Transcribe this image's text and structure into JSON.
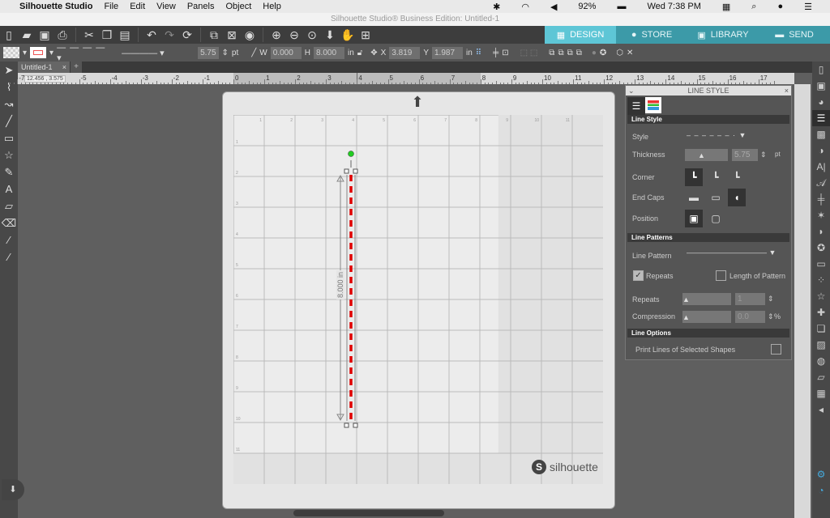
{
  "menubar": {
    "app": "Silhouette Studio",
    "items": [
      "File",
      "Edit",
      "View",
      "Panels",
      "Object",
      "Help"
    ],
    "battery": "92%",
    "clock": "Wed 7:38 PM"
  },
  "window_title": "Silhouette Studio® Business Edition: Untitled-1",
  "toolbar": {
    "icons": [
      "new-file",
      "open-folder",
      "save",
      "print",
      "cut",
      "copy",
      "paste",
      "undo",
      "redo",
      "replicate",
      "group",
      "ungroup",
      "release",
      "zoom-in",
      "zoom-out",
      "zoom-select",
      "pan-down",
      "hand",
      "fit-page"
    ],
    "nav_tabs": [
      {
        "label": "DESIGN",
        "active": true
      },
      {
        "label": "STORE"
      },
      {
        "label": "LIBRARY"
      },
      {
        "label": "SEND"
      }
    ]
  },
  "props": {
    "thickness": "5.75",
    "thickness_unit": "pt",
    "w_label": "W",
    "w": "0.000",
    "h_label": "H",
    "h": "8.000",
    "unit": "in",
    "x_label": "X",
    "x": "3.819",
    "y_label": "Y",
    "y": "1.987"
  },
  "tabs": {
    "doc": "Untitled-1",
    "close": "×",
    "add": "+"
  },
  "ruler": {
    "coord": "12.456 , 3.575",
    "ticks": [
      "-7",
      "-6",
      "-5",
      "-4",
      "-3",
      "-2",
      "-1",
      "0",
      "1",
      "2",
      "3",
      "4",
      "5",
      "6",
      "7",
      "8",
      "9",
      "10",
      "11",
      "12",
      "13",
      "14",
      "15",
      "16",
      "17"
    ]
  },
  "canvas": {
    "dimension_label": "8.000 in",
    "brand": "silhouette",
    "line_color": "#e00000",
    "handle_color": "#22cc22"
  },
  "panel": {
    "title": "LINE STYLE",
    "sections": {
      "style": "Line Style",
      "patterns": "Line Patterns",
      "options": "Line Options"
    },
    "style_label": "Style",
    "thickness_label": "Thickness",
    "thickness": "5.75",
    "thickness_unit": "pt",
    "corner_label": "Corner",
    "endcaps_label": "End Caps",
    "position_label": "Position",
    "line_pattern_label": "Line Pattern",
    "repeats_check": "Repeats",
    "repeats_checked": true,
    "length_check": "Length of Pattern",
    "length_checked": false,
    "repeats_label": "Repeats",
    "repeats": "1",
    "compression_label": "Compression",
    "compression": "0.0",
    "compression_unit": "%",
    "print_lines": "Print Lines of Selected Shapes",
    "print_lines_checked": false
  },
  "accent": "#5ec6d6"
}
